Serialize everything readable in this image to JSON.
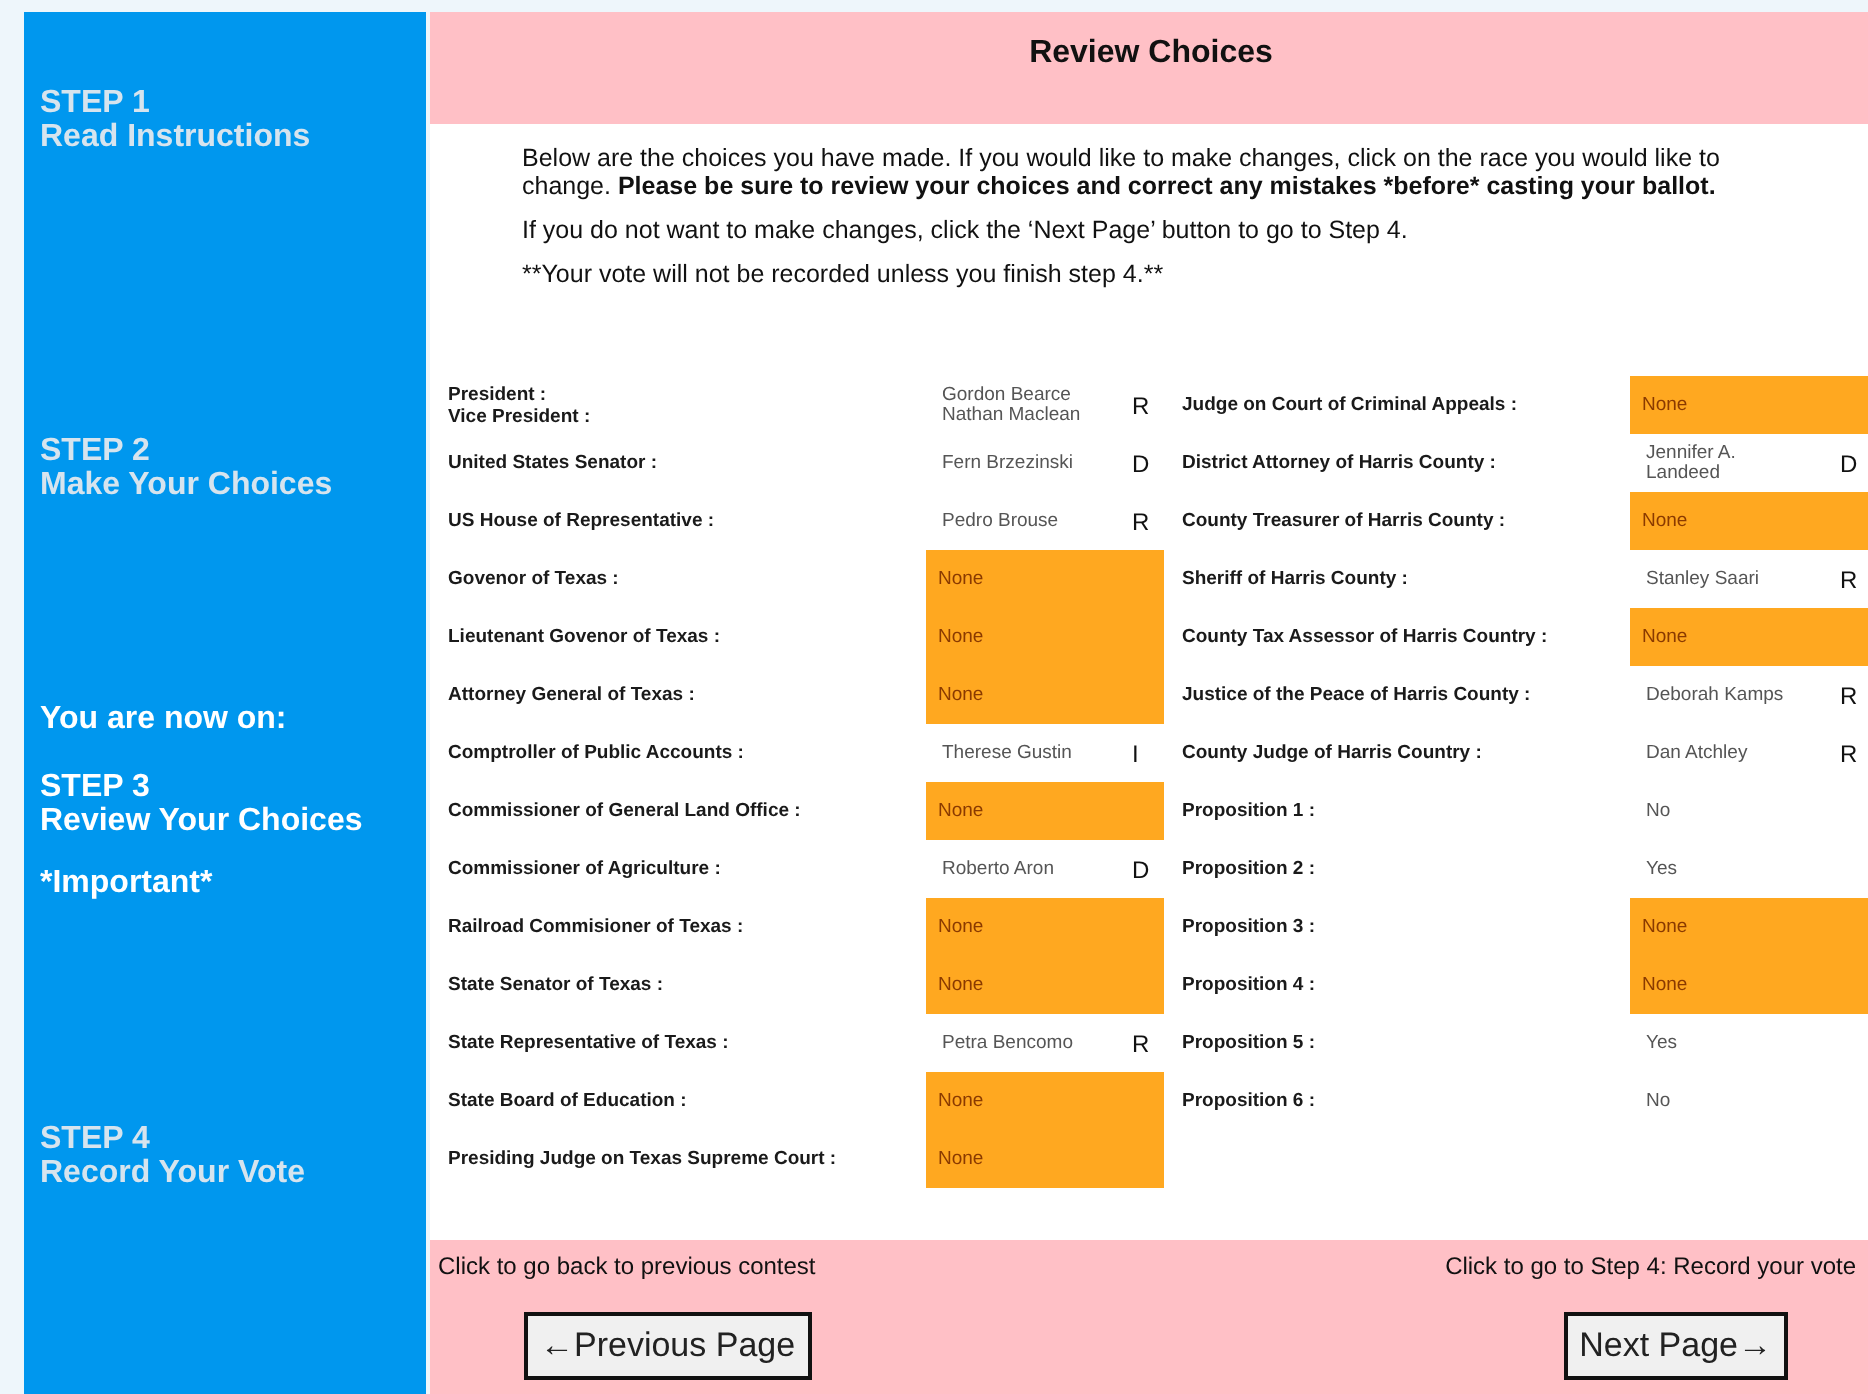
{
  "sidebar": {
    "items": [
      {
        "kind": "step",
        "title": "STEP 1",
        "subtitle": "Read Instructions",
        "current": false
      },
      {
        "kind": "step",
        "title": "STEP 2",
        "subtitle": "Make Your Choices",
        "current": false
      },
      {
        "kind": "note",
        "text": "You are now on:"
      },
      {
        "kind": "step",
        "title": "STEP 3",
        "subtitle": "Review Your Choices",
        "current": true
      },
      {
        "kind": "note",
        "text": "*Important*"
      },
      {
        "kind": "step",
        "title": "STEP 4",
        "subtitle": "Record Your Vote",
        "current": false
      }
    ]
  },
  "header": {
    "title": "Review Choices"
  },
  "instructions": [
    {
      "plain": "Below are the choices you have made. If you would like to make changes, click on the race you would like to change. ",
      "bold": "Please be sure to review your choices and correct any mistakes *before* casting your ballot."
    },
    {
      "plain": "If you do not want to make changes, click the ‘Next Page’ button to go to Step 4."
    },
    {
      "plain": "**Your vote will not be recorded unless you finish step 4.**"
    }
  ],
  "races_left": [
    {
      "label": [
        "President :",
        "Vice President :"
      ],
      "choice": [
        "Gordon Bearce",
        "Nathan Maclean"
      ],
      "party": "R",
      "missing": false
    },
    {
      "label": [
        "United States Senator :"
      ],
      "choice": [
        "Fern Brzezinski"
      ],
      "party": "D",
      "missing": false
    },
    {
      "label": [
        "US House of Representative :"
      ],
      "choice": [
        "Pedro Brouse"
      ],
      "party": "R",
      "missing": false
    },
    {
      "label": [
        "Govenor of Texas :"
      ],
      "choice": [
        "None"
      ],
      "missing": true
    },
    {
      "label": [
        "Lieutenant Govenor of Texas :"
      ],
      "choice": [
        "None"
      ],
      "missing": true
    },
    {
      "label": [
        "Attorney General of Texas :"
      ],
      "choice": [
        "None"
      ],
      "missing": true
    },
    {
      "label": [
        "Comptroller of Public Accounts :"
      ],
      "choice": [
        "Therese Gustin"
      ],
      "party": "I",
      "missing": false
    },
    {
      "label": [
        "Commissioner of General Land Office :"
      ],
      "choice": [
        "None"
      ],
      "missing": true
    },
    {
      "label": [
        "Commissioner of Agriculture :"
      ],
      "choice": [
        "Roberto Aron"
      ],
      "party": "D",
      "missing": false
    },
    {
      "label": [
        "Railroad Commisioner of Texas :"
      ],
      "choice": [
        "None"
      ],
      "missing": true
    },
    {
      "label": [
        "State Senator of Texas :"
      ],
      "choice": [
        "None"
      ],
      "missing": true
    },
    {
      "label": [
        "State Representative of Texas :"
      ],
      "choice": [
        "Petra Bencomo"
      ],
      "party": "R",
      "missing": false
    },
    {
      "label": [
        "State Board of Education :"
      ],
      "choice": [
        "None"
      ],
      "missing": true
    },
    {
      "label": [
        "Presiding Judge on Texas Supreme Court :"
      ],
      "choice": [
        "None"
      ],
      "missing": true
    }
  ],
  "races_right": [
    {
      "label": [
        "Judge on Court of Criminal Appeals :"
      ],
      "choice": [
        "None"
      ],
      "missing": true
    },
    {
      "label": [
        "District Attorney of Harris County :"
      ],
      "choice": [
        "Jennifer A.",
        "Landeed"
      ],
      "party": "D",
      "missing": false
    },
    {
      "label": [
        "County Treasurer of Harris County :"
      ],
      "choice": [
        "None"
      ],
      "missing": true
    },
    {
      "label": [
        "Sheriff of Harris County :"
      ],
      "choice": [
        "Stanley Saari"
      ],
      "party": "R",
      "missing": false
    },
    {
      "label": [
        "County Tax Assessor of Harris Country :"
      ],
      "choice": [
        "None"
      ],
      "missing": true
    },
    {
      "label": [
        "Justice of the Peace of Harris County :"
      ],
      "choice": [
        "Deborah Kamps"
      ],
      "party": "R",
      "missing": false
    },
    {
      "label": [
        "County Judge of Harris Country :"
      ],
      "choice": [
        "Dan Atchley"
      ],
      "party": "R",
      "missing": false
    },
    {
      "label": [
        "Proposition 1 :"
      ],
      "choice": [
        "No"
      ],
      "missing": false
    },
    {
      "label": [
        "Proposition 2 :"
      ],
      "choice": [
        "Yes"
      ],
      "missing": false
    },
    {
      "label": [
        "Proposition 3 :"
      ],
      "choice": [
        "None"
      ],
      "missing": true
    },
    {
      "label": [
        "Proposition 4 :"
      ],
      "choice": [
        "None"
      ],
      "missing": true
    },
    {
      "label": [
        "Proposition 5 :"
      ],
      "choice": [
        "Yes"
      ],
      "missing": false
    },
    {
      "label": [
        "Proposition 6 :"
      ],
      "choice": [
        "No"
      ],
      "missing": false
    }
  ],
  "footer": {
    "back_hint": "Click to go back to previous contest",
    "next_hint": "Click to go to Step 4: Record your vote",
    "previous_button": "←Previous Page",
    "next_button": "Next Page→"
  }
}
